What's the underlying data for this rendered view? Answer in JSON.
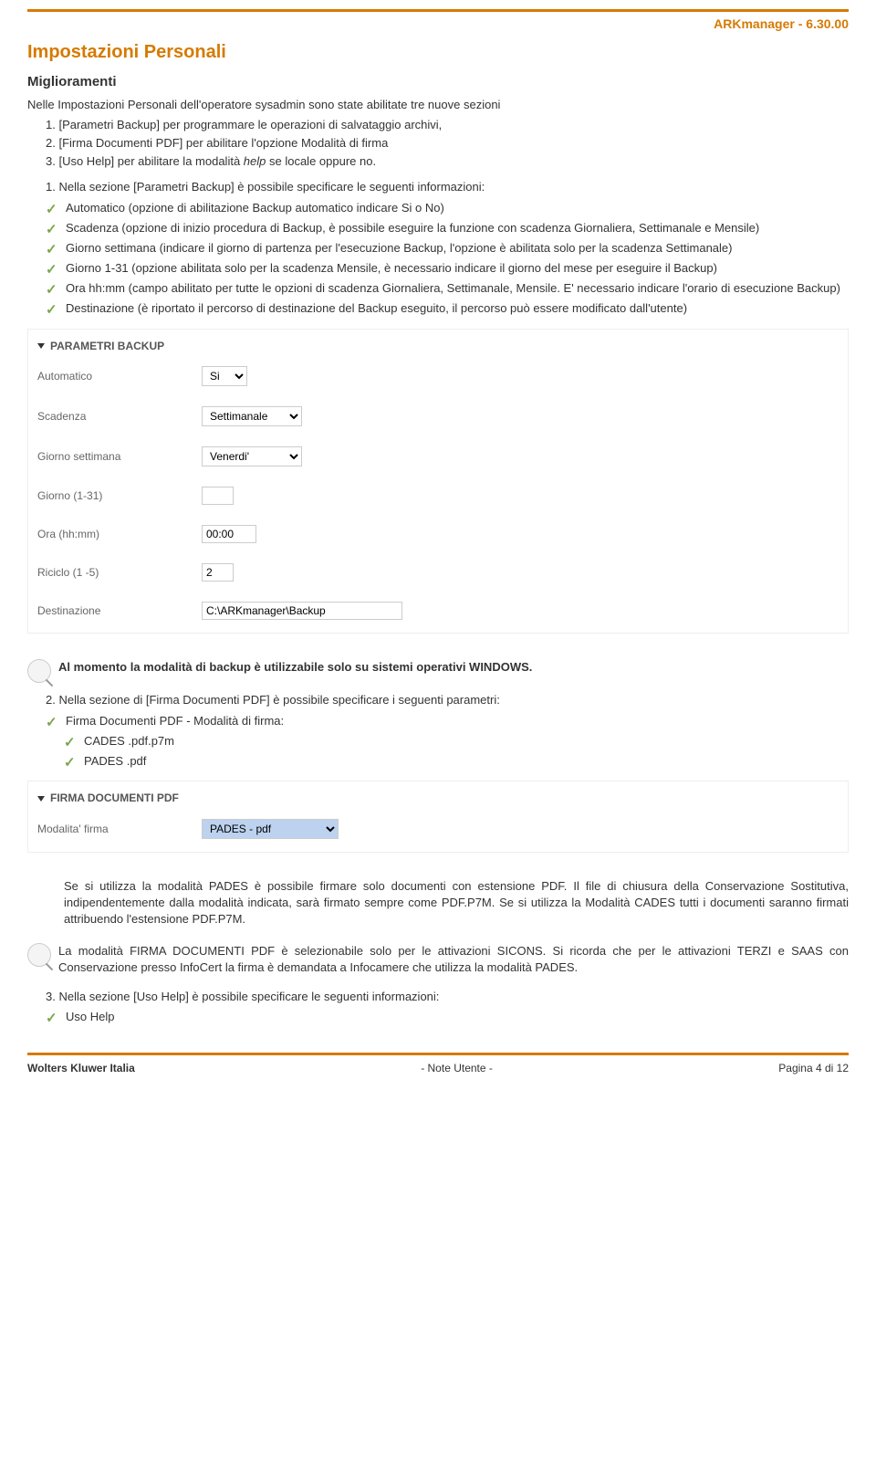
{
  "header": {
    "product": "ARKmanager - 6.30.00"
  },
  "section": {
    "title": "Impostazioni Personali",
    "subtitle": "Miglioramenti",
    "intro": "Nelle Impostazioni Personali dell'operatore sysadmin sono state abilitate tre nuove sezioni",
    "numbered": [
      "[Parametri Backup] per programmare le operazioni di salvataggio archivi,",
      "[Firma Documenti PDF] per abilitare l'opzione Modalità di firma",
      "[Uso Help] per abilitare la modalità help se locale oppure no."
    ],
    "lead1": "Nella sezione [Parametri Backup] è possibile specificare le seguenti informazioni:",
    "checks1": [
      "Automatico (opzione di abilitazione Backup automatico indicare Si o No)",
      "Scadenza (opzione di inizio procedura di Backup, è possibile eseguire la funzione con scadenza Giornaliera, Settimanale e Mensile)",
      "Giorno settimana (indicare il giorno di partenza per l'esecuzione Backup, l'opzione è abilitata solo per la scadenza Settimanale)",
      "Giorno 1-31 (opzione abilitata solo per la scadenza Mensile, è necessario indicare il giorno del mese per eseguire il Backup)",
      "Ora hh:mm (campo abilitato per tutte le opzioni di scadenza Giornaliera, Settimanale, Mensile. E' necessario indicare l'orario di esecuzione Backup)",
      "Destinazione (è riportato il percorso di destinazione del Backup eseguito, il percorso può essere modificato dall'utente)"
    ]
  },
  "screenshot1": {
    "title": "PARAMETRI BACKUP",
    "rows": {
      "automatico": {
        "label": "Automatico",
        "value": "Si"
      },
      "scadenza": {
        "label": "Scadenza",
        "value": "Settimanale"
      },
      "giorno_settimana": {
        "label": "Giorno settimana",
        "value": "Venerdi'"
      },
      "giorno_131": {
        "label": "Giorno (1-31)",
        "value": ""
      },
      "ora": {
        "label": "Ora (hh:mm)",
        "value": "00:00"
      },
      "riciclo": {
        "label": "Riciclo (1 -5)",
        "value": "2"
      },
      "destinazione": {
        "label": "Destinazione",
        "value": "C:\\ARKmanager\\Backup"
      }
    }
  },
  "note1": "Al momento la modalità di backup è utilizzabile solo su sistemi operativi WINDOWS.",
  "lead2": "Nella sezione di [Firma Documenti PDF] è possibile specificare i seguenti parametri:",
  "checks2": {
    "firma": "Firma Documenti PDF - Modalità di firma:",
    "sub": [
      "CADES .pdf.p7m",
      "PADES .pdf"
    ]
  },
  "screenshot2": {
    "title": "FIRMA DOCUMENTI PDF",
    "row": {
      "label": "Modalita' firma",
      "value": "PADES - pdf"
    }
  },
  "para_pades": "Se si utilizza la modalità PADES è possibile firmare solo documenti con estensione PDF. Il file di chiusura della Conservazione Sostitutiva, indipendentemente dalla modalità indicata, sarà firmato sempre come PDF.P7M. Se si utilizza la Modalità CADES tutti i documenti saranno firmati attribuendo l'estensione PDF.P7M.",
  "note2": "La modalità FIRMA DOCUMENTI PDF è selezionabile solo per le attivazioni SICONS. Si ricorda che per le attivazioni TERZI e SAAS con Conservazione presso InfoCert la firma è demandata a Infocamere che utilizza la modalità PADES.",
  "lead3": "Nella sezione [Uso Help] è possibile specificare le seguenti informazioni:",
  "checks3": [
    "Uso Help"
  ],
  "footer": {
    "left": "Wolters Kluwer Italia",
    "center": "- Note Utente -",
    "right": "Pagina 4 di 12"
  }
}
